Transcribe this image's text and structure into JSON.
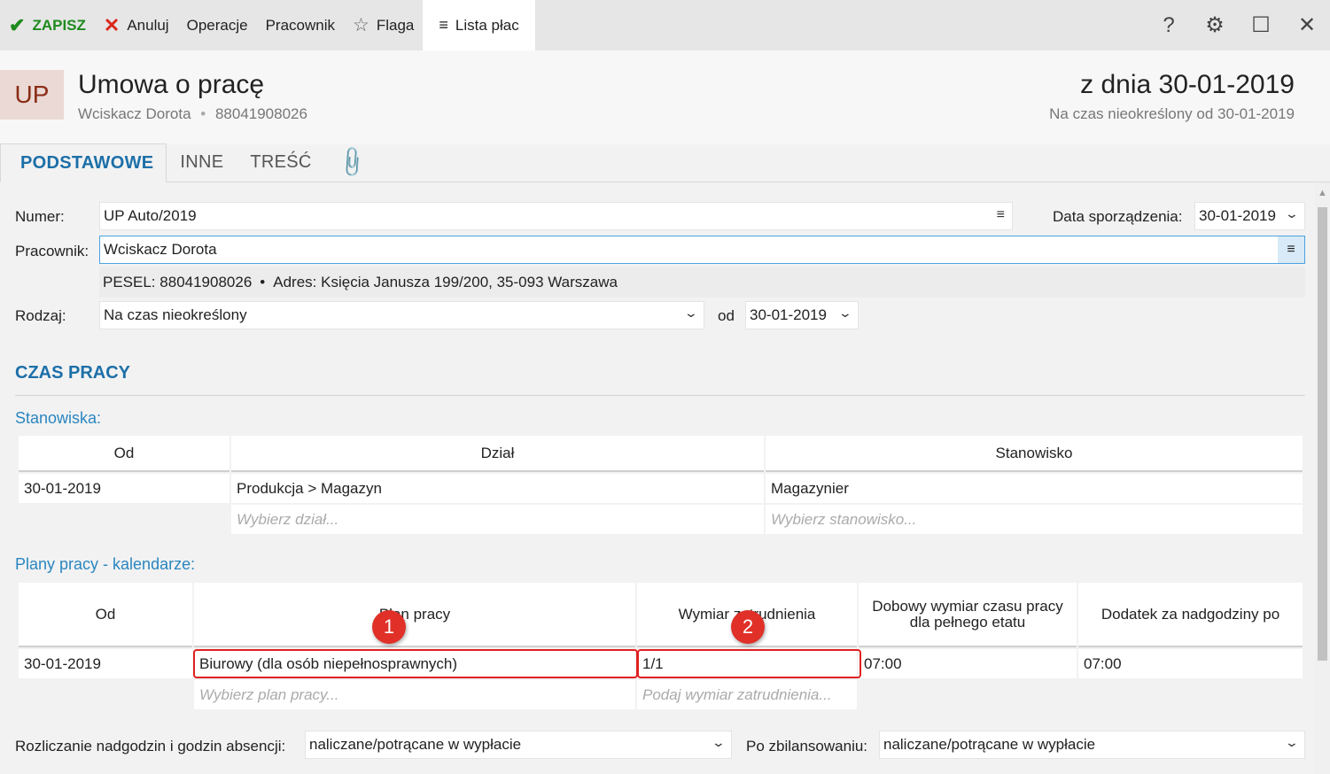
{
  "toolbar": {
    "save": "ZAPISZ",
    "cancel": "Anuluj",
    "operations": "Operacje",
    "employee": "Pracownik",
    "flag": "Flaga",
    "payroll": "Lista płac",
    "help": "?",
    "colors": {
      "save": "#1e8a1e",
      "cancel": "#d9281e"
    }
  },
  "header": {
    "badge": "UP",
    "title": "Umowa o pracę",
    "employee_name": "Wciskacz Dorota",
    "separator": "•",
    "pesel": "88041908026",
    "date_title": "z dnia 30-01-2019",
    "date_subtitle": "Na czas nieokreślony od 30-01-2019"
  },
  "tabs": [
    {
      "label": "PODSTAWOWE",
      "active": true
    },
    {
      "label": "INNE"
    },
    {
      "label": "TREŚĆ"
    }
  ],
  "form": {
    "number_label": "Numer:",
    "number_value": "UP Auto/2019",
    "created_label": "Data sporządzenia:",
    "created_value": "30-01-2019",
    "employee_label": "Pracownik:",
    "employee_value": "Wciskacz Dorota",
    "pesel_label": "PESEL:",
    "pesel_value": "88041908026",
    "address_label": "Adres:",
    "address_value": "Księcia Janusza 199/200, 35-093 Warszawa",
    "kind_label": "Rodzaj:",
    "kind_value": "Na czas nieokreślony",
    "from_label": "od",
    "from_value": "30-01-2019"
  },
  "work_time": {
    "title": "CZAS PRACY",
    "positions_title": "Stanowiska:",
    "positions_headers": [
      "Od",
      "Dział",
      "Stanowisko"
    ],
    "positions_rows": [
      [
        "30-01-2019",
        "Produkcja > Magazyn",
        "Magazynier"
      ]
    ],
    "positions_placeholders": [
      "Wybierz dział...",
      "Wybierz stanowisko..."
    ],
    "plans_title": "Plany pracy - kalendarze:",
    "plans_headers": [
      "Od",
      "Plan pracy",
      "Wymiar zatrudnienia",
      "Dobowy wymiar czasu pracy dla pełnego etatu",
      "Dodatek za nadgodziny po"
    ],
    "plans_rows": [
      [
        "30-01-2019",
        "Biurowy (dla osób niepełnosprawnych)",
        "1/1",
        "07:00",
        "07:00"
      ]
    ],
    "plans_placeholders": [
      "Wybierz plan pracy...",
      "Podaj wymiar zatrudnienia..."
    ],
    "overtime_label": "Rozliczanie nadgodzin i godzin absencji:",
    "overtime_value": "naliczane/potrącane w wypłacie",
    "balanced_label": "Po zbilansowaniu:",
    "balanced_value": "naliczane/potrącane w wypłacie"
  },
  "annotations": [
    "1",
    "2"
  ]
}
